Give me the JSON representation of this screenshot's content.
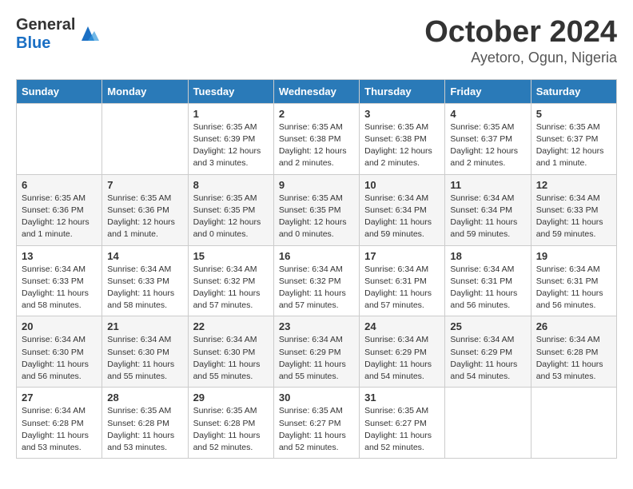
{
  "header": {
    "logo_general": "General",
    "logo_blue": "Blue",
    "month": "October 2024",
    "location": "Ayetoro, Ogun, Nigeria"
  },
  "days_of_week": [
    "Sunday",
    "Monday",
    "Tuesday",
    "Wednesday",
    "Thursday",
    "Friday",
    "Saturday"
  ],
  "weeks": [
    [
      {
        "day": "",
        "info": ""
      },
      {
        "day": "",
        "info": ""
      },
      {
        "day": "1",
        "info": "Sunrise: 6:35 AM\nSunset: 6:39 PM\nDaylight: 12 hours\nand 3 minutes."
      },
      {
        "day": "2",
        "info": "Sunrise: 6:35 AM\nSunset: 6:38 PM\nDaylight: 12 hours\nand 2 minutes."
      },
      {
        "day": "3",
        "info": "Sunrise: 6:35 AM\nSunset: 6:38 PM\nDaylight: 12 hours\nand 2 minutes."
      },
      {
        "day": "4",
        "info": "Sunrise: 6:35 AM\nSunset: 6:37 PM\nDaylight: 12 hours\nand 2 minutes."
      },
      {
        "day": "5",
        "info": "Sunrise: 6:35 AM\nSunset: 6:37 PM\nDaylight: 12 hours\nand 1 minute."
      }
    ],
    [
      {
        "day": "6",
        "info": "Sunrise: 6:35 AM\nSunset: 6:36 PM\nDaylight: 12 hours\nand 1 minute."
      },
      {
        "day": "7",
        "info": "Sunrise: 6:35 AM\nSunset: 6:36 PM\nDaylight: 12 hours\nand 1 minute."
      },
      {
        "day": "8",
        "info": "Sunrise: 6:35 AM\nSunset: 6:35 PM\nDaylight: 12 hours\nand 0 minutes."
      },
      {
        "day": "9",
        "info": "Sunrise: 6:35 AM\nSunset: 6:35 PM\nDaylight: 12 hours\nand 0 minutes."
      },
      {
        "day": "10",
        "info": "Sunrise: 6:34 AM\nSunset: 6:34 PM\nDaylight: 11 hours\nand 59 minutes."
      },
      {
        "day": "11",
        "info": "Sunrise: 6:34 AM\nSunset: 6:34 PM\nDaylight: 11 hours\nand 59 minutes."
      },
      {
        "day": "12",
        "info": "Sunrise: 6:34 AM\nSunset: 6:33 PM\nDaylight: 11 hours\nand 59 minutes."
      }
    ],
    [
      {
        "day": "13",
        "info": "Sunrise: 6:34 AM\nSunset: 6:33 PM\nDaylight: 11 hours\nand 58 minutes."
      },
      {
        "day": "14",
        "info": "Sunrise: 6:34 AM\nSunset: 6:33 PM\nDaylight: 11 hours\nand 58 minutes."
      },
      {
        "day": "15",
        "info": "Sunrise: 6:34 AM\nSunset: 6:32 PM\nDaylight: 11 hours\nand 57 minutes."
      },
      {
        "day": "16",
        "info": "Sunrise: 6:34 AM\nSunset: 6:32 PM\nDaylight: 11 hours\nand 57 minutes."
      },
      {
        "day": "17",
        "info": "Sunrise: 6:34 AM\nSunset: 6:31 PM\nDaylight: 11 hours\nand 57 minutes."
      },
      {
        "day": "18",
        "info": "Sunrise: 6:34 AM\nSunset: 6:31 PM\nDaylight: 11 hours\nand 56 minutes."
      },
      {
        "day": "19",
        "info": "Sunrise: 6:34 AM\nSunset: 6:31 PM\nDaylight: 11 hours\nand 56 minutes."
      }
    ],
    [
      {
        "day": "20",
        "info": "Sunrise: 6:34 AM\nSunset: 6:30 PM\nDaylight: 11 hours\nand 56 minutes."
      },
      {
        "day": "21",
        "info": "Sunrise: 6:34 AM\nSunset: 6:30 PM\nDaylight: 11 hours\nand 55 minutes."
      },
      {
        "day": "22",
        "info": "Sunrise: 6:34 AM\nSunset: 6:30 PM\nDaylight: 11 hours\nand 55 minutes."
      },
      {
        "day": "23",
        "info": "Sunrise: 6:34 AM\nSunset: 6:29 PM\nDaylight: 11 hours\nand 55 minutes."
      },
      {
        "day": "24",
        "info": "Sunrise: 6:34 AM\nSunset: 6:29 PM\nDaylight: 11 hours\nand 54 minutes."
      },
      {
        "day": "25",
        "info": "Sunrise: 6:34 AM\nSunset: 6:29 PM\nDaylight: 11 hours\nand 54 minutes."
      },
      {
        "day": "26",
        "info": "Sunrise: 6:34 AM\nSunset: 6:28 PM\nDaylight: 11 hours\nand 53 minutes."
      }
    ],
    [
      {
        "day": "27",
        "info": "Sunrise: 6:34 AM\nSunset: 6:28 PM\nDaylight: 11 hours\nand 53 minutes."
      },
      {
        "day": "28",
        "info": "Sunrise: 6:35 AM\nSunset: 6:28 PM\nDaylight: 11 hours\nand 53 minutes."
      },
      {
        "day": "29",
        "info": "Sunrise: 6:35 AM\nSunset: 6:28 PM\nDaylight: 11 hours\nand 52 minutes."
      },
      {
        "day": "30",
        "info": "Sunrise: 6:35 AM\nSunset: 6:27 PM\nDaylight: 11 hours\nand 52 minutes."
      },
      {
        "day": "31",
        "info": "Sunrise: 6:35 AM\nSunset: 6:27 PM\nDaylight: 11 hours\nand 52 minutes."
      },
      {
        "day": "",
        "info": ""
      },
      {
        "day": "",
        "info": ""
      }
    ]
  ]
}
